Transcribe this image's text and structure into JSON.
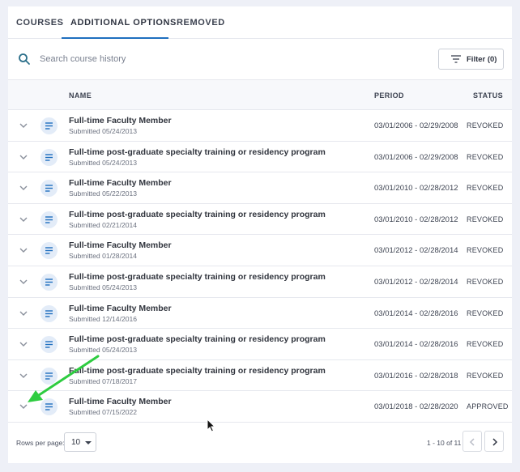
{
  "tabs": [
    {
      "label": "COURSES"
    },
    {
      "label": "ADDITIONAL OPTIONS"
    },
    {
      "label": "REMOVED"
    }
  ],
  "search": {
    "placeholder": "Search course history"
  },
  "filter": {
    "label": "Filter (0)"
  },
  "table": {
    "headers": {
      "name": "NAME",
      "period": "PERIOD",
      "status": "STATUS"
    },
    "rows": [
      {
        "name": "Full-time Faculty Member",
        "submitted": "Submitted 05/24/2013",
        "period": "03/01/2006 - 02/29/2008",
        "status": "REVOKED"
      },
      {
        "name": "Full-time post-graduate specialty training or residency program",
        "submitted": "Submitted 05/24/2013",
        "period": "03/01/2006 - 02/29/2008",
        "status": "REVOKED"
      },
      {
        "name": "Full-time Faculty Member",
        "submitted": "Submitted 05/22/2013",
        "period": "03/01/2010 - 02/28/2012",
        "status": "REVOKED"
      },
      {
        "name": "Full-time post-graduate specialty training or residency program",
        "submitted": "Submitted 02/21/2014",
        "period": "03/01/2010 - 02/28/2012",
        "status": "REVOKED"
      },
      {
        "name": "Full-time Faculty Member",
        "submitted": "Submitted 01/28/2014",
        "period": "03/01/2012 - 02/28/2014",
        "status": "REVOKED"
      },
      {
        "name": "Full-time post-graduate specialty training or residency program",
        "submitted": "Submitted 05/24/2013",
        "period": "03/01/2012 - 02/28/2014",
        "status": "REVOKED"
      },
      {
        "name": "Full-time Faculty Member",
        "submitted": "Submitted 12/14/2016",
        "period": "03/01/2014 - 02/28/2016",
        "status": "REVOKED"
      },
      {
        "name": "Full-time post-graduate specialty training or residency program",
        "submitted": "Submitted 05/24/2013",
        "period": "03/01/2014 - 02/28/2016",
        "status": "REVOKED"
      },
      {
        "name": "Full-time post-graduate specialty training or residency program",
        "submitted": "Submitted 07/18/2017",
        "period": "03/01/2016 - 02/28/2018",
        "status": "REVOKED"
      },
      {
        "name": "Full-time Faculty Member",
        "submitted": "Submitted 07/15/2022",
        "period": "03/01/2018 - 02/28/2020",
        "status": "APPROVED"
      }
    ]
  },
  "pagination": {
    "rows_per_page_label": "Rows per page:",
    "rows_per_page": "10",
    "range": "1 - 10 of 11"
  },
  "colors": {
    "accent": "#1f6fbf",
    "annotation_arrow": "#2ecc40",
    "doc_icon": "#1f6fbf"
  },
  "icons": [
    "search-icon",
    "filter-icon",
    "chevron-down-icon",
    "document-icon",
    "chevron-left-icon",
    "chevron-right-icon",
    "arrow-annotation",
    "mouse-cursor"
  ]
}
